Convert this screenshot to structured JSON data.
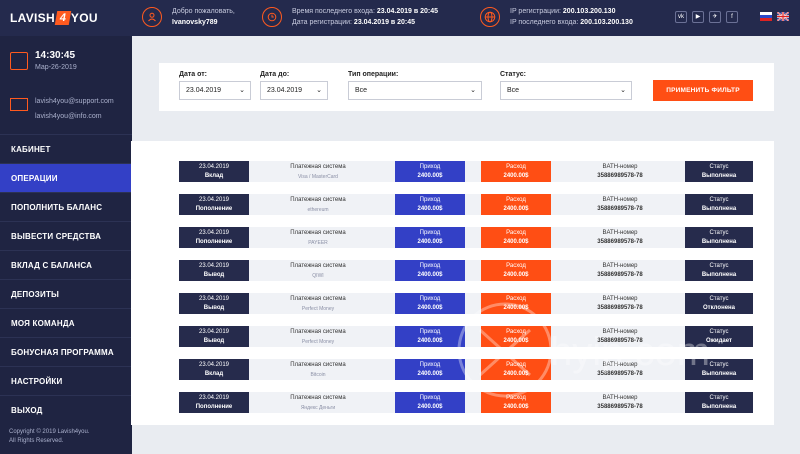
{
  "header": {
    "logo_left": "LAVISH",
    "logo_mark": "4",
    "logo_right": "YOU",
    "welcome_label": "Добро пожаловать,",
    "username": "Ivanovsky789",
    "last_login_label": "Время последнего входа:",
    "last_login_value": "23.04.2019 в 20:45",
    "reg_date_label": "Дата регистрации:",
    "reg_date_value": "23.04.2019 в 20:45",
    "ip_reg_label": "IP регистрации:",
    "ip_reg_value": "200.103.200.130",
    "ip_last_label": "IP последнего входа:",
    "ip_last_value": "200.103.200.130",
    "social": [
      "vk",
      "youtube",
      "telegram",
      "facebook"
    ],
    "languages": [
      "ru",
      "en"
    ],
    "accent": "#ff5a1f"
  },
  "sidebar": {
    "time": "14:30:45",
    "date": "Мар-26-2019",
    "emails": [
      "lavish4you@support.com",
      "lavish4you@info.com"
    ],
    "items": [
      {
        "label": "КАБИНЕТ"
      },
      {
        "label": "ОПЕРАЦИИ"
      },
      {
        "label": "ПОПОЛНИТЬ БАЛАНС"
      },
      {
        "label": "ВЫВЕСТИ СРЕДСТВА"
      },
      {
        "label": "ВКЛАД С БАЛАНСА"
      },
      {
        "label": "ДЕПОЗИТЫ"
      },
      {
        "label": "МОЯ КОМАНДА"
      },
      {
        "label": "БОНУСНАЯ ПРОГРАММА"
      },
      {
        "label": "НАСТРОЙКИ"
      },
      {
        "label": "ВЫХОД"
      }
    ],
    "active_item": "ОПЕРАЦИИ",
    "copyright_1": "Copyright © 2019 Lavish4you.",
    "copyright_2": "All Rights Reserved."
  },
  "filter": {
    "date_from_label": "Дата от:",
    "date_from_value": "23.04.2019",
    "date_to_label": "Дата до:",
    "date_to_value": "23.04.2019",
    "type_label": "Тип операции:",
    "type_value": "Все",
    "status_label": "Статус:",
    "status_value": "Все",
    "apply_label": "ПРИМЕНИТЬ ФИЛЬТР"
  },
  "operations": {
    "payment_system_label": "Платежная система",
    "income_label": "Приход",
    "expense_label": "Расход",
    "bath_label": "BATH-номер",
    "status_label": "Статус",
    "rows": [
      {
        "date": "23.04.2019",
        "type": "Вклад",
        "system": "Visa / MasterCard",
        "income": "2400.00$",
        "expense": "2400.00$",
        "bath": "35886989578-78",
        "status": "Выполнена"
      },
      {
        "date": "23.04.2019",
        "type": "Пополнение",
        "system": "ethereum",
        "income": "2400.00$",
        "expense": "2400.00$",
        "bath": "35886989578-78",
        "status": "Выполнена"
      },
      {
        "date": "23.04.2019",
        "type": "Пополнение",
        "system": "PAYEER",
        "income": "2400.00$",
        "expense": "2400.00$",
        "bath": "35886989578-78",
        "status": "Выполнена"
      },
      {
        "date": "23.04.2019",
        "type": "Вывод",
        "system": "QIWI",
        "income": "2400.00$",
        "expense": "2400.00$",
        "bath": "35886989578-78",
        "status": "Выполнена"
      },
      {
        "date": "23.04.2019",
        "type": "Вывод",
        "system": "Perfect Money",
        "income": "2400.00$",
        "expense": "2400.00$",
        "bath": "35886989578-78",
        "status": "Отклонена"
      },
      {
        "date": "23.04.2019",
        "type": "Вывод",
        "system": "Perfect Money",
        "income": "2400.00$",
        "expense": "2400.00$",
        "bath": "35886989578-78",
        "status": "Ожидает"
      },
      {
        "date": "23.04.2019",
        "type": "Вклад",
        "system": "Bitcoin",
        "income": "2400.00$",
        "expense": "2400.00$",
        "bath": "35886989578-78",
        "status": "Выполнена"
      },
      {
        "date": "23.04.2019",
        "type": "Пополнение",
        "system": "Яндекс Деньги",
        "income": "2400.00$",
        "expense": "2400.00$",
        "bath": "35886989578-78",
        "status": "Выполнена"
      }
    ]
  },
  "watermark": "hyip.com"
}
